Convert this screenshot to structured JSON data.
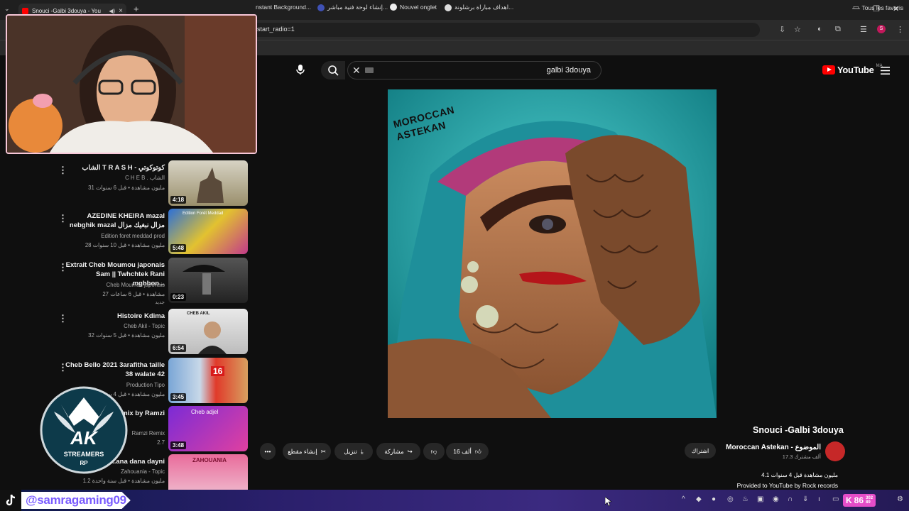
{
  "browser": {
    "tab_title": "Snouci -Galbi 3douya - You",
    "url_text": "start_radio=1",
    "bookmarks": [
      {
        "label": "nstant Background..."
      },
      {
        "label": "إنشاء لوحة فنية مباشر..."
      },
      {
        "label": "Nouvel onglet"
      },
      {
        "label": "اهداف مباراة برشلونة..."
      }
    ],
    "all_bookmarks": "Tous les favoris",
    "profile_initial": "S"
  },
  "youtube": {
    "logo_text": "YouTube",
    "logo_region": "MA",
    "search_value": "galbi 3douya",
    "artwork_text": "MOROCCAN ASTEKAN",
    "video_title": "Snouci -Galbi 3douya",
    "channel_name": "Moroccan Astekan - الموضوع",
    "channel_subs": "17.3 ألف مشترك",
    "subscribe_label": "اشتراك",
    "likes": "16 ألف",
    "share_label": "مشاركة",
    "download_label": "تنزيل",
    "clip_label": "إنشاء مقطع",
    "views_line": "4.1 مليون مشاهدة  قبل 4 سنوات",
    "provided_line": "Provided to YouTube by Rock records"
  },
  "related": [
    {
      "title": "الشاب T R A S H - كوتوكوتي",
      "channel": "C H E B . الشاب",
      "meta": "31 مليون مشاهدة • قبل 6 سنوات",
      "duration": "4:18",
      "extra": ""
    },
    {
      "title": "AZEDINE KHEIRA mazal nebghik mazal مزال نبغيك مزال",
      "channel": "Edition foret meddad prod",
      "meta": "28 مليون مشاهدة • قبل 10 سنوات",
      "duration": "5:48",
      "extra": ""
    },
    {
      "title": "Extrait Cheb Moumou japonais Sam || Twhchtek Rani mghbon...",
      "channel": "Cheb Moumou japonais",
      "meta": "27 مشاهدة • قبل 6 ساعات",
      "duration": "0:23",
      "extra": "جديد"
    },
    {
      "title": "Histoire Kdima",
      "channel": "Cheb Akil - Topic",
      "meta": "32 مليون مشاهدة • قبل 5 سنوات",
      "duration": "6:54",
      "extra": ""
    },
    {
      "title": "Cheb Bello 2021 3arafitha taille 38 walate 42",
      "channel": "Production Tipo",
      "meta": "17 مليون مشاهدة • قبل 4 سنوات",
      "duration": "3:45",
      "extra": ""
    },
    {
      "title": "...mol lhabat Dj ...mix by Ramzi",
      "channel": "Ramzi Remix",
      "meta": "2.7",
      "duration": "3:48",
      "extra": ""
    },
    {
      "title": "...ana dana dayni",
      "channel": "Zahouania - Topic",
      "meta": "1.2 مليون مشاهدة • قبل سنة واحدة",
      "duration": "",
      "extra": ""
    }
  ],
  "thumbnails": [
    {
      "caption": ""
    },
    {
      "caption": "Edition Forét Meddad"
    },
    {
      "caption": ""
    },
    {
      "caption": "CHEB AKIL"
    },
    {
      "caption": "16"
    },
    {
      "caption": "Cheb adjel"
    },
    {
      "caption": "ZAHOUANIA"
    }
  ],
  "overlay": {
    "streamer_logo_top": "AK",
    "streamer_logo_mid": "STREAMERS",
    "streamer_logo_bottom": "RP",
    "tiktok_handle": "@samragaming09",
    "viewer_count": "86",
    "viewer_small_top": "302",
    "viewer_small_bottom": "89"
  }
}
